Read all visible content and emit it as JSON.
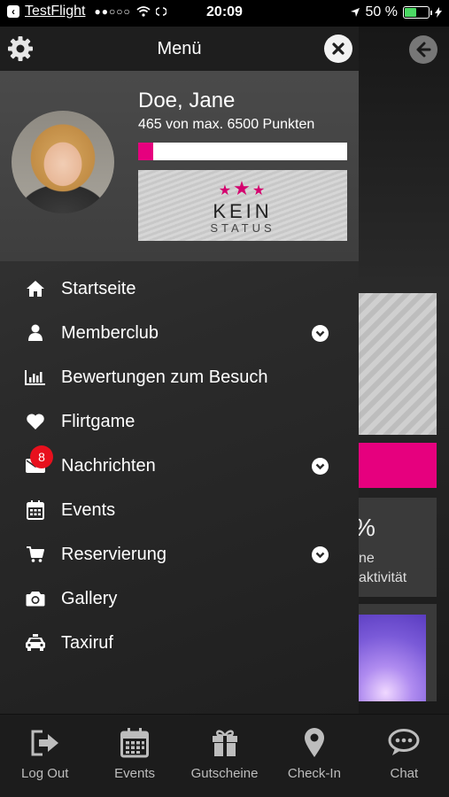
{
  "status_bar": {
    "back_app": "TestFlight",
    "signal": "●●○○○",
    "time": "20:09",
    "battery_text": "50 %",
    "battery_level": 0.5
  },
  "drawer": {
    "title": "Menü",
    "profile": {
      "name": "Doe, Jane",
      "points_text": "465  von max. 6500 Punkten",
      "points": 465,
      "points_max": 6500,
      "status_line1": "KEIN",
      "status_line2": "STATUS"
    },
    "menu": [
      {
        "label": "Startseite",
        "icon": "home-icon"
      },
      {
        "label": "Memberclub",
        "icon": "person-icon",
        "expandable": true
      },
      {
        "label": "Bewertungen zum Besuch",
        "icon": "bar-chart-icon"
      },
      {
        "label": "Flirtgame",
        "icon": "heart-icon"
      },
      {
        "label": "Nachrichten",
        "icon": "envelope-icon",
        "expandable": true,
        "badge": "8"
      },
      {
        "label": "Events",
        "icon": "calendar-icon"
      },
      {
        "label": "Reservierung",
        "icon": "cart-icon",
        "expandable": true
      },
      {
        "label": "Gallery",
        "icon": "camera-icon"
      },
      {
        "label": "Taxiruf",
        "icon": "taxi-icon"
      }
    ]
  },
  "background": {
    "percent_text": "%",
    "line1": "ne",
    "line2": "aktivität"
  },
  "tabbar": [
    {
      "label": "Log Out",
      "icon": "logout-icon"
    },
    {
      "label": "Events",
      "icon": "calendar-icon"
    },
    {
      "label": "Gutscheine",
      "icon": "gift-icon"
    },
    {
      "label": "Check-In",
      "icon": "location-pin-icon"
    },
    {
      "label": "Chat",
      "icon": "chat-bubble-icon"
    }
  ],
  "colors": {
    "accent": "#e6007e",
    "badge": "#e8101d"
  }
}
